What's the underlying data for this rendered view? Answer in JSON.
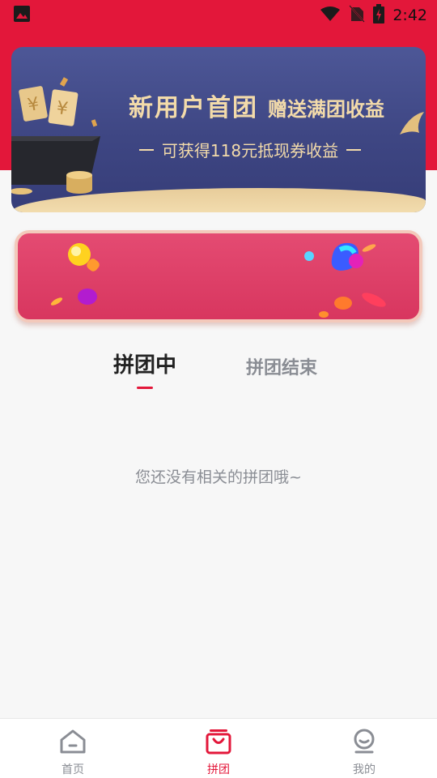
{
  "status_bar": {
    "time": "2:42",
    "icons": [
      "image-icon",
      "wifi-icon",
      "no-sim-icon",
      "battery-charging-icon"
    ]
  },
  "banner": {
    "title": "新用户首团",
    "title_suffix": "赠送满团收益",
    "subtitle": "可获得118元抵现券收益"
  },
  "tabs": {
    "active": "拼团中",
    "inactive": "拼团结束"
  },
  "empty_state": {
    "message": "您还没有相关的拼团哦~"
  },
  "bottom_nav": {
    "items": [
      {
        "label": "首页",
        "icon": "home-icon",
        "active": false
      },
      {
        "label": "拼团",
        "icon": "group-bag-icon",
        "active": true
      },
      {
        "label": "我的",
        "icon": "profile-icon",
        "active": false
      }
    ]
  },
  "colors": {
    "brand_red": "#e3173a",
    "banner_blue": "#434c8a",
    "gold_text": "#f3dbaa",
    "promo_pink": "#df4168"
  }
}
